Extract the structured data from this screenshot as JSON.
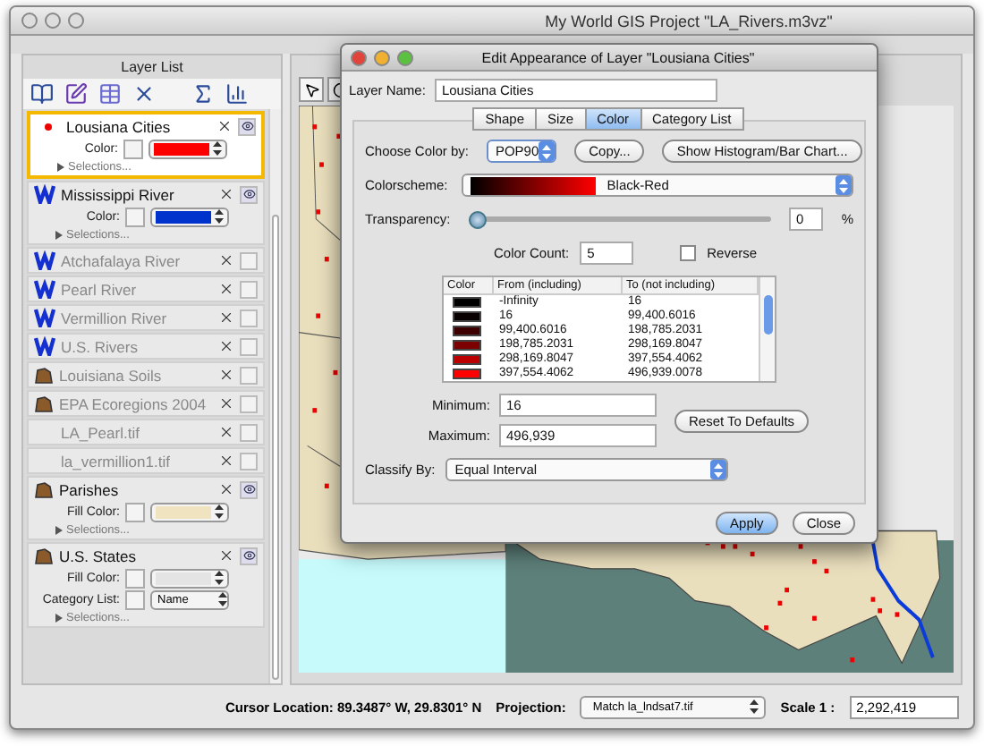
{
  "window": {
    "title": "My World GIS Project \"LA_Rivers.m3vz\""
  },
  "layer_list": {
    "title": "Layer List",
    "layers": [
      {
        "name": "Lousiana Cities",
        "kind": "point",
        "selected": true,
        "visible": true,
        "properties": [
          {
            "label": "Color:",
            "kind": "color",
            "color": "#ff0000"
          }
        ],
        "selections": "Selections..."
      },
      {
        "name": "Mississippi  River",
        "kind": "line",
        "selected": false,
        "visible": true,
        "properties": [
          {
            "label": "Color:",
            "kind": "color",
            "color": "#0033cc"
          }
        ],
        "selections": "Selections..."
      },
      {
        "name": "Atchafalaya River",
        "kind": "line",
        "selected": false,
        "visible": false
      },
      {
        "name": "Pearl River",
        "kind": "line",
        "selected": false,
        "visible": false
      },
      {
        "name": "Vermillion River",
        "kind": "line",
        "selected": false,
        "visible": false
      },
      {
        "name": "U.S. Rivers",
        "kind": "line",
        "selected": false,
        "visible": false
      },
      {
        "name": "Louisiana Soils",
        "kind": "polygon",
        "selected": false,
        "visible": false
      },
      {
        "name": "EPA Ecoregions 2004",
        "kind": "polygon",
        "selected": false,
        "visible": false
      },
      {
        "name": "LA_Pearl.tif",
        "kind": "raster",
        "selected": false,
        "visible": false
      },
      {
        "name": "la_vermillion1.tif",
        "kind": "raster",
        "selected": false,
        "visible": false
      },
      {
        "name": "Parishes",
        "kind": "polygon",
        "selected": false,
        "visible": true,
        "properties": [
          {
            "label": "Fill Color:",
            "kind": "color",
            "color": "#efe3c0"
          }
        ],
        "selections": "Selections..."
      },
      {
        "name": "U.S. States",
        "kind": "polygon",
        "selected": false,
        "visible": true,
        "properties": [
          {
            "label": "Fill Color:",
            "kind": "color",
            "color": "#e4e4e4"
          },
          {
            "label": "Category List:",
            "kind": "select",
            "value": "Name"
          }
        ],
        "selections": "Selections..."
      }
    ]
  },
  "dialog": {
    "title": "Edit Appearance of Layer \"Lousiana Cities\"",
    "layer_name": {
      "label": "Layer Name:",
      "value": "Lousiana Cities"
    },
    "tabs": [
      {
        "label": "Shape",
        "selected": false
      },
      {
        "label": "Size",
        "selected": false
      },
      {
        "label": "Color",
        "selected": true
      },
      {
        "label": "Category List",
        "selected": false
      }
    ],
    "choose_color_by": {
      "label": "Choose Color by:",
      "value": "POP90"
    },
    "top_buttons": [
      "Copy...",
      "Show Histogram/Bar Chart..."
    ],
    "colorscheme": {
      "label": "Colorscheme:",
      "value": "Black-Red"
    },
    "transparency": {
      "label": "Transparency:",
      "level": 0,
      "value": "0",
      "unit": "%"
    },
    "color_count": {
      "label": "Color Count:",
      "value": "5"
    },
    "reverse": {
      "label": "Reverse",
      "checked": false
    },
    "table": {
      "columns": [
        "Color",
        "From (including)",
        "To (not including)"
      ],
      "rows": [
        {
          "color": "#000000",
          "from": "-Infinity",
          "to": "16"
        },
        {
          "color": "#080000",
          "from": "16",
          "to": "99,400.6016"
        },
        {
          "color": "#3c0000",
          "from": "99,400.6016",
          "to": "198,785.2031"
        },
        {
          "color": "#7c0000",
          "from": "198,785.2031",
          "to": "298,169.8047"
        },
        {
          "color": "#bc0000",
          "from": "298,169.8047",
          "to": "397,554.4062"
        },
        {
          "color": "#ff0000",
          "from": "397,554.4062",
          "to": "496,939.0078"
        }
      ]
    },
    "minimum": {
      "label": "Minimum:",
      "value": "16"
    },
    "maximum": {
      "label": "Maximum:",
      "value": "496,939"
    },
    "reset_button": "Reset To Defaults",
    "classify_by": {
      "label": "Classify By:",
      "value": "Equal Interval"
    },
    "buttons": [
      {
        "label": "Apply",
        "default": true
      },
      {
        "label": "Close",
        "default": false
      }
    ]
  },
  "status_bar": {
    "cursor_location": "Cursor Location: 89.3487° W, 29.8301° N",
    "projection": {
      "label": "Projection:",
      "value": "Match la_lndsat7.tif"
    },
    "scale": {
      "label": "Scale 1 :",
      "value": "2,292,419"
    }
  }
}
